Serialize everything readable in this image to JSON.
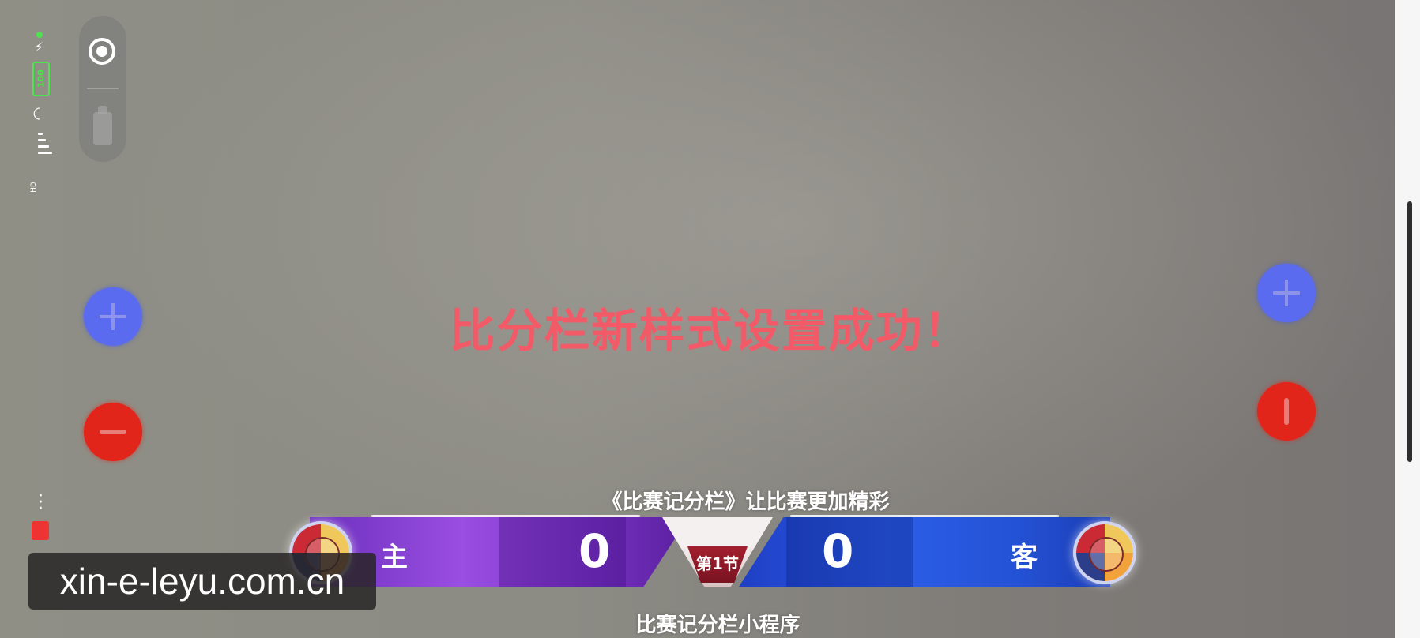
{
  "status": {
    "battery": "100",
    "network": "HD"
  },
  "message": {
    "success": "比分栏新样式设置成功！"
  },
  "scoreboard": {
    "slogan": "《比赛记分栏》让比赛更加精彩",
    "home_label": "主",
    "away_label": "客",
    "home_score": "0",
    "away_score": "0",
    "period": "第1节",
    "app_name": "比赛记分栏小程序"
  },
  "watermark": {
    "text": "xin-e-leyu.com.cn"
  },
  "colors": {
    "plus": "#5a6bf0",
    "minus": "#e1251b",
    "home": "#8a44d8",
    "away": "#2b5ee8",
    "message": "#f25a68"
  },
  "icons": [
    "record-icon",
    "photo-icon",
    "plus-icon",
    "minus-icon",
    "more-vert-icon",
    "wifi-icon",
    "signal-icon",
    "battery-icon",
    "charging-icon"
  ]
}
